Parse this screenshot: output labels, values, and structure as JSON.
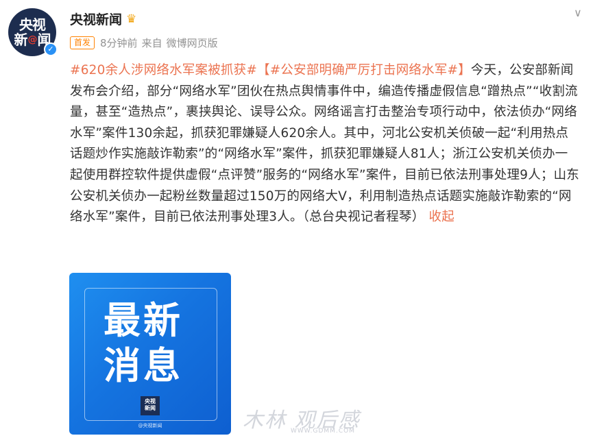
{
  "account": {
    "avatar_line1": "央视",
    "avatar_line2a": "新",
    "avatar_at": "@",
    "avatar_line2b": "闻",
    "verified_mark": "✓",
    "name": "央视新闻",
    "crown_icon": "♛"
  },
  "meta": {
    "badge": "首发",
    "time": "8分钟前",
    "source_prefix": "来自",
    "source": "微博网页版"
  },
  "more_icon": "∨",
  "post": {
    "topic1": "#620余人涉网络水军案被抓获#",
    "topic2": "【#公安部明确严厉打击网络水军#】",
    "body": "今天，公安部新闻发布会介绍，部分“网络水军”团伙在热点舆情事件中，编造传播虚假信息“蹭热点”“收割流量，甚至“造热点”，裹挟舆论、误导公众。网络谣言打击整治专项行动中，依法侦办“网络水军”案件130余起，抓获犯罪嫌疑人620余人。其中，河北公安机关侦破一起“利用热点话题炒作实施敲诈勒索”的“网络水军”案件，抓获犯罪嫌疑人81人；浙江公安机关侦办一起使用群控软件提供虚假“点评赞”服务的“网络水军”案件，目前已依法刑事处理9人；山东公安机关侦办一起粉丝数量超过150万的网络大V，利用制造热点话题实施敲诈勒索的“网络水军”案件，目前已依法刑事处理3人。（总台央视记者程琴）",
    "collapse": "收起"
  },
  "image": {
    "line1": "最新",
    "line2": "消息",
    "logo_line1": "央视",
    "logo_line2": "新闻",
    "caption": "@央视新闻"
  },
  "watermark": {
    "text": "木林 观后感",
    "url": "WWW.GDMM.COM"
  }
}
